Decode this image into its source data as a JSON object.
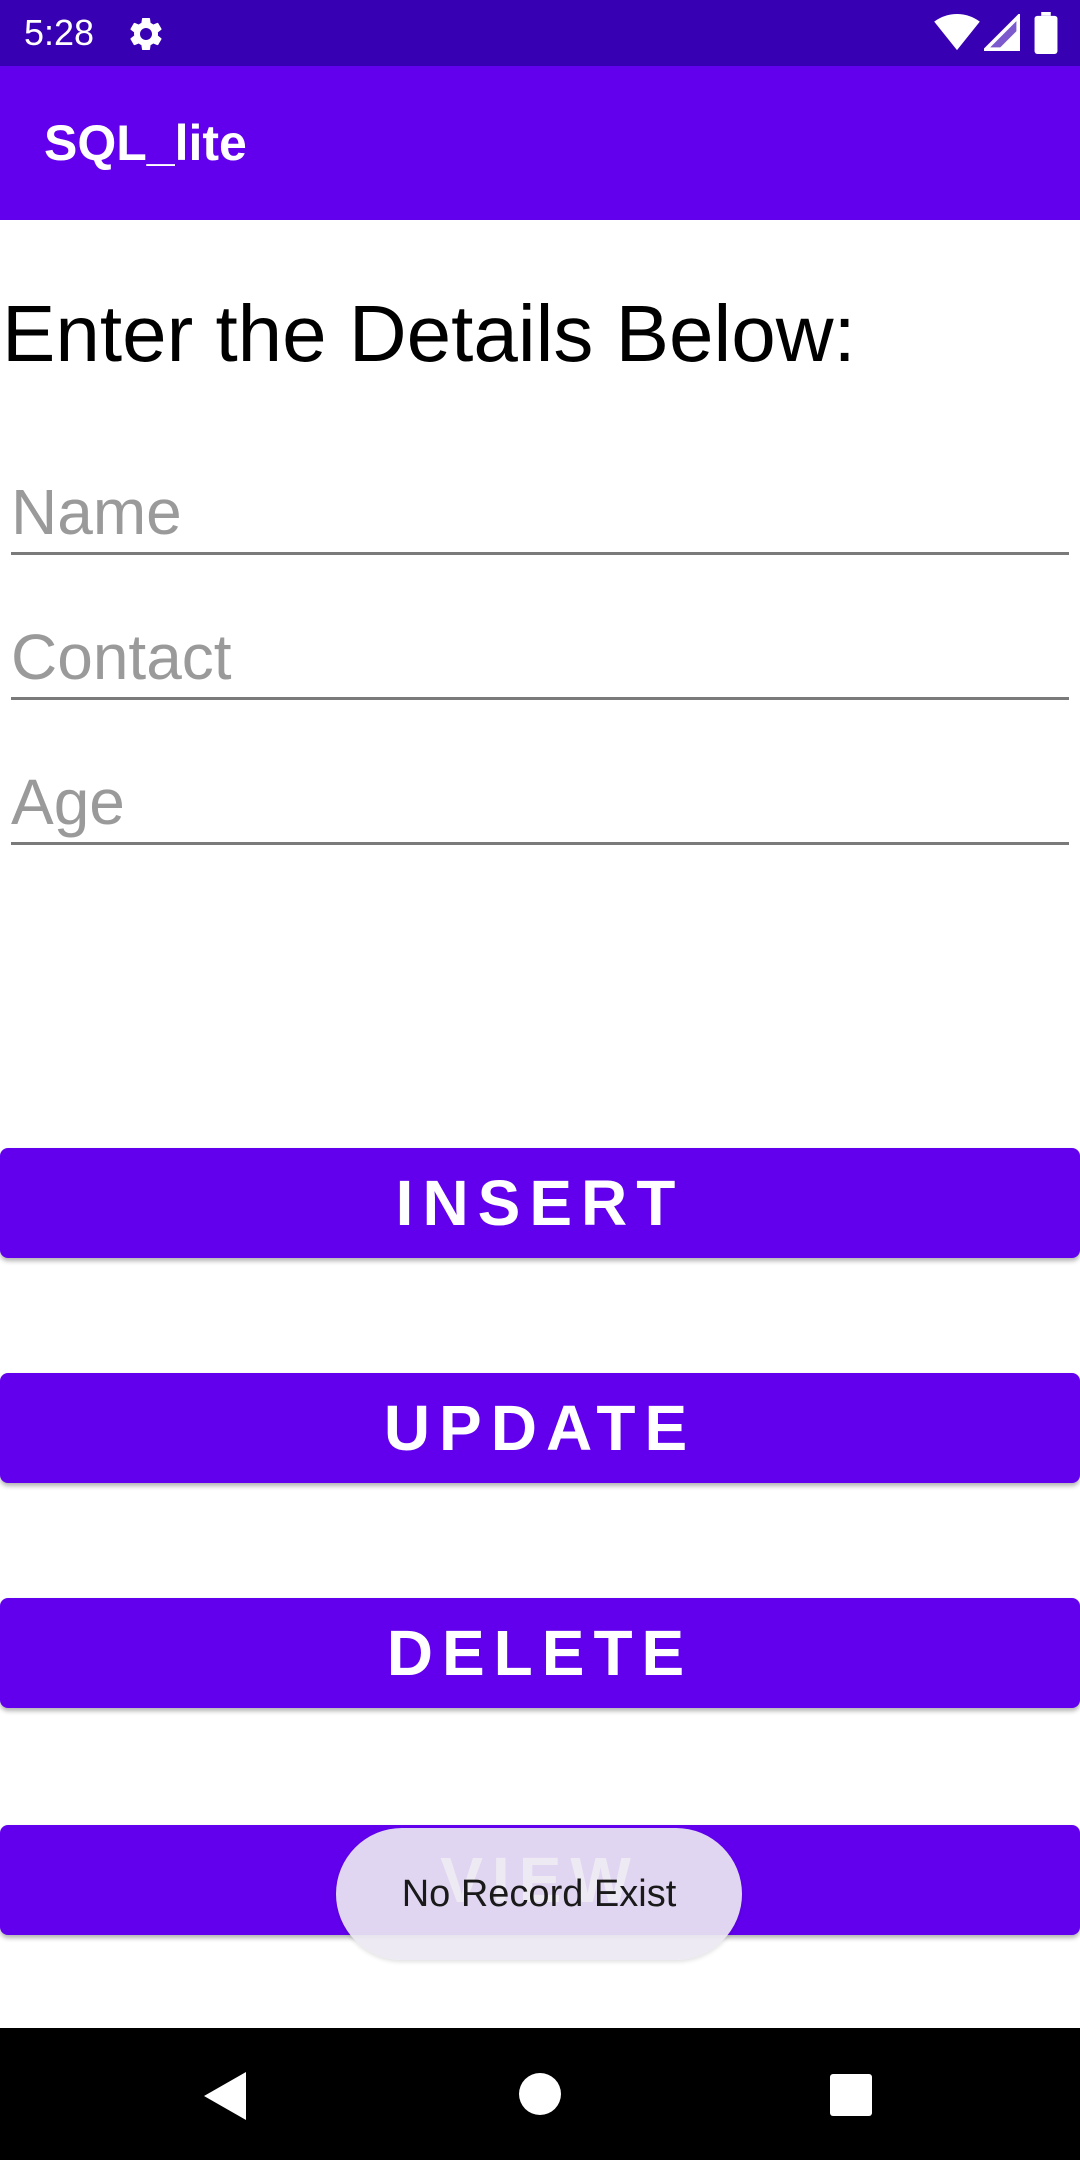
{
  "status_bar": {
    "time": "5:28",
    "icons": [
      "gear-icon",
      "wifi-icon",
      "cell-signal-icon",
      "battery-icon"
    ],
    "background": "#3700b3"
  },
  "app_bar": {
    "title": "SQL_lite",
    "background": "#6200ee"
  },
  "form": {
    "heading": "Enter the Details Below:",
    "name_placeholder": "Name",
    "contact_placeholder": "Contact",
    "age_placeholder": "Age"
  },
  "buttons": {
    "insert": "INSERT",
    "update": "UPDATE",
    "delete": "DELETE",
    "view": "VIEW",
    "color": "#6200ee"
  },
  "toast": {
    "message": "No Record Exist"
  },
  "nav_bar": {
    "icons": [
      "back-icon",
      "home-icon",
      "recents-icon"
    ]
  }
}
